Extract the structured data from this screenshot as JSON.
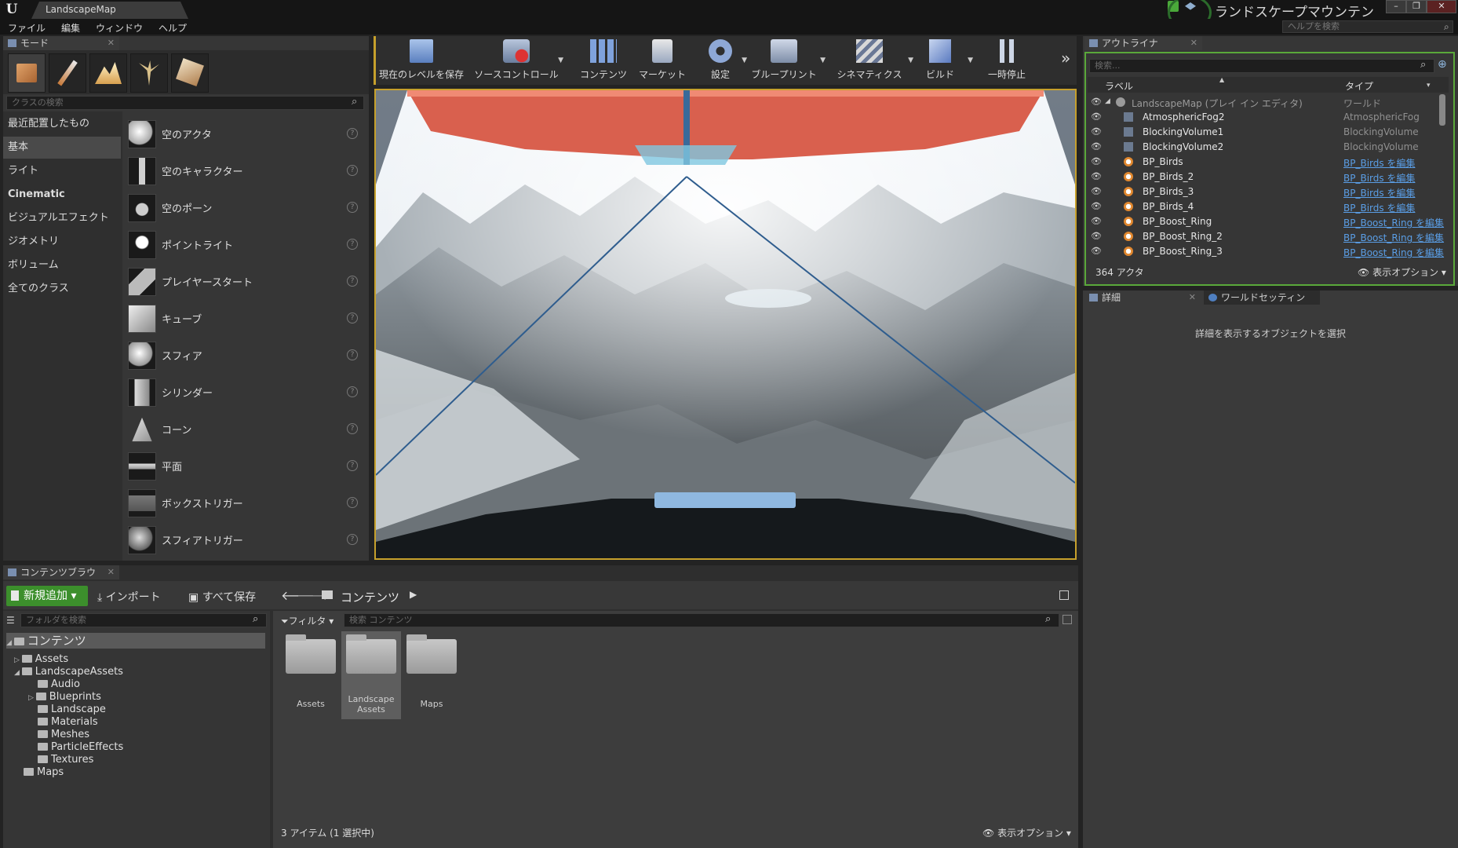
{
  "app": {
    "logo": "U",
    "document_tab": "LandscapeMap",
    "project_title": "ランドスケープマウンテン",
    "help_search_placeholder": "ヘルプを検索",
    "window_buttons": [
      "–",
      "❐",
      "✕"
    ]
  },
  "menu": [
    "ファイル",
    "編集",
    "ウィンドウ",
    "ヘルプ"
  ],
  "modes": {
    "tab_label": "モード",
    "mode_icons": [
      "place-mode-icon",
      "paint-mode-icon",
      "landscape-mode-icon",
      "foliage-mode-icon",
      "geometry-mode-icon"
    ],
    "search_placeholder": "クラスの検索",
    "categories": [
      "最近配置したもの",
      "基本",
      "ライト",
      "Cinematic",
      "ビジュアルエフェクト",
      "ジオメトリ",
      "ボリューム",
      "全てのクラス"
    ],
    "selected_category": "基本",
    "items": [
      "空のアクタ",
      "空のキャラクター",
      "空のポーン",
      "ポイントライト",
      "プレイヤースタート",
      "キューブ",
      "スフィア",
      "シリンダー",
      "コーン",
      "平面",
      "ボックストリガー",
      "スフィアトリガー"
    ]
  },
  "toolbar": {
    "buttons": [
      {
        "label": "現在のレベルを保存",
        "icon": "save-icon",
        "dropdown": false
      },
      {
        "label": "ソースコントロール",
        "icon": "source-control-icon",
        "dropdown": true
      },
      {
        "label": "コンテンツ",
        "icon": "content-icon",
        "dropdown": false
      },
      {
        "label": "マーケット",
        "icon": "marketplace-icon",
        "dropdown": false
      },
      {
        "label": "設定",
        "icon": "settings-icon",
        "dropdown": true
      },
      {
        "label": "ブループリント",
        "icon": "blueprint-icon",
        "dropdown": true
      },
      {
        "label": "シネマティクス",
        "icon": "cinematics-icon",
        "dropdown": true
      },
      {
        "label": "ビルド",
        "icon": "build-icon",
        "dropdown": true
      },
      {
        "label": "一時停止",
        "icon": "pause-icon",
        "dropdown": false
      }
    ],
    "overflow": "»"
  },
  "outliner": {
    "tab_label": "アウトライナ",
    "search_placeholder": "検索...",
    "col_label": "ラベル",
    "col_type": "タイプ",
    "rows": [
      {
        "label": "LandscapeMap (プレイ イン エディタ)",
        "type": "ワールド",
        "link": false,
        "root": true
      },
      {
        "label": "AtmosphericFog2",
        "type": "AtmosphericFog",
        "link": false
      },
      {
        "label": "BlockingVolume1",
        "type": "BlockingVolume",
        "link": false
      },
      {
        "label": "BlockingVolume2",
        "type": "BlockingVolume",
        "link": false
      },
      {
        "label": "BP_Birds",
        "type": "BP_Birds を編集",
        "link": true
      },
      {
        "label": "BP_Birds_2",
        "type": "BP_Birds を編集",
        "link": true
      },
      {
        "label": "BP_Birds_3",
        "type": "BP_Birds を編集",
        "link": true
      },
      {
        "label": "BP_Birds_4",
        "type": "BP_Birds を編集",
        "link": true
      },
      {
        "label": "BP_Boost_Ring",
        "type": "BP_Boost_Ring を編集",
        "link": true
      },
      {
        "label": "BP_Boost_Ring_2",
        "type": "BP_Boost_Ring を編集",
        "link": true
      },
      {
        "label": "BP_Boost_Ring_3",
        "type": "BP_Boost_Ring を編集",
        "link": true
      }
    ],
    "actor_count": "364 アクタ",
    "view_options": "表示オプション"
  },
  "details": {
    "tab_label": "詳細",
    "world_settings_tab": "ワールドセッティン",
    "empty_message": "詳細を表示するオブジェクトを選択"
  },
  "content_browser": {
    "tab_label": "コンテンツブラウ",
    "add_new": "新規追加",
    "import": "インポート",
    "save_all": "すべて保存",
    "path_root": "コンテンツ",
    "folder_search_placeholder": "フォルダを検索",
    "filters": "フィルタ",
    "content_search_placeholder": "検索 コンテンツ",
    "tree": [
      {
        "label": "コンテンツ",
        "depth": 0,
        "expanded": true,
        "root": true
      },
      {
        "label": "Assets",
        "depth": 1,
        "expanded": false,
        "arrow": true
      },
      {
        "label": "LandscapeAssets",
        "depth": 1,
        "expanded": true,
        "arrow": true
      },
      {
        "label": "Audio",
        "depth": 2
      },
      {
        "label": "Blueprints",
        "depth": 2,
        "arrow": true
      },
      {
        "label": "Landscape",
        "depth": 2
      },
      {
        "label": "Materials",
        "depth": 2
      },
      {
        "label": "Meshes",
        "depth": 2
      },
      {
        "label": "ParticleEffects",
        "depth": 2
      },
      {
        "label": "Textures",
        "depth": 2
      },
      {
        "label": "Maps",
        "depth": 1
      }
    ],
    "assets": [
      {
        "name": "Assets",
        "selected": false
      },
      {
        "name": "Landscape\nAssets",
        "selected": true
      },
      {
        "name": "Maps",
        "selected": false
      }
    ],
    "status": "3 アイテム (1 選択中)",
    "view_options": "表示オプション"
  },
  "colors": {
    "accent_green": "#5aa83a",
    "viewport_border": "#c6a02c",
    "link_blue": "#5a9ee6",
    "outliner_highlight": "#5aa83a"
  }
}
